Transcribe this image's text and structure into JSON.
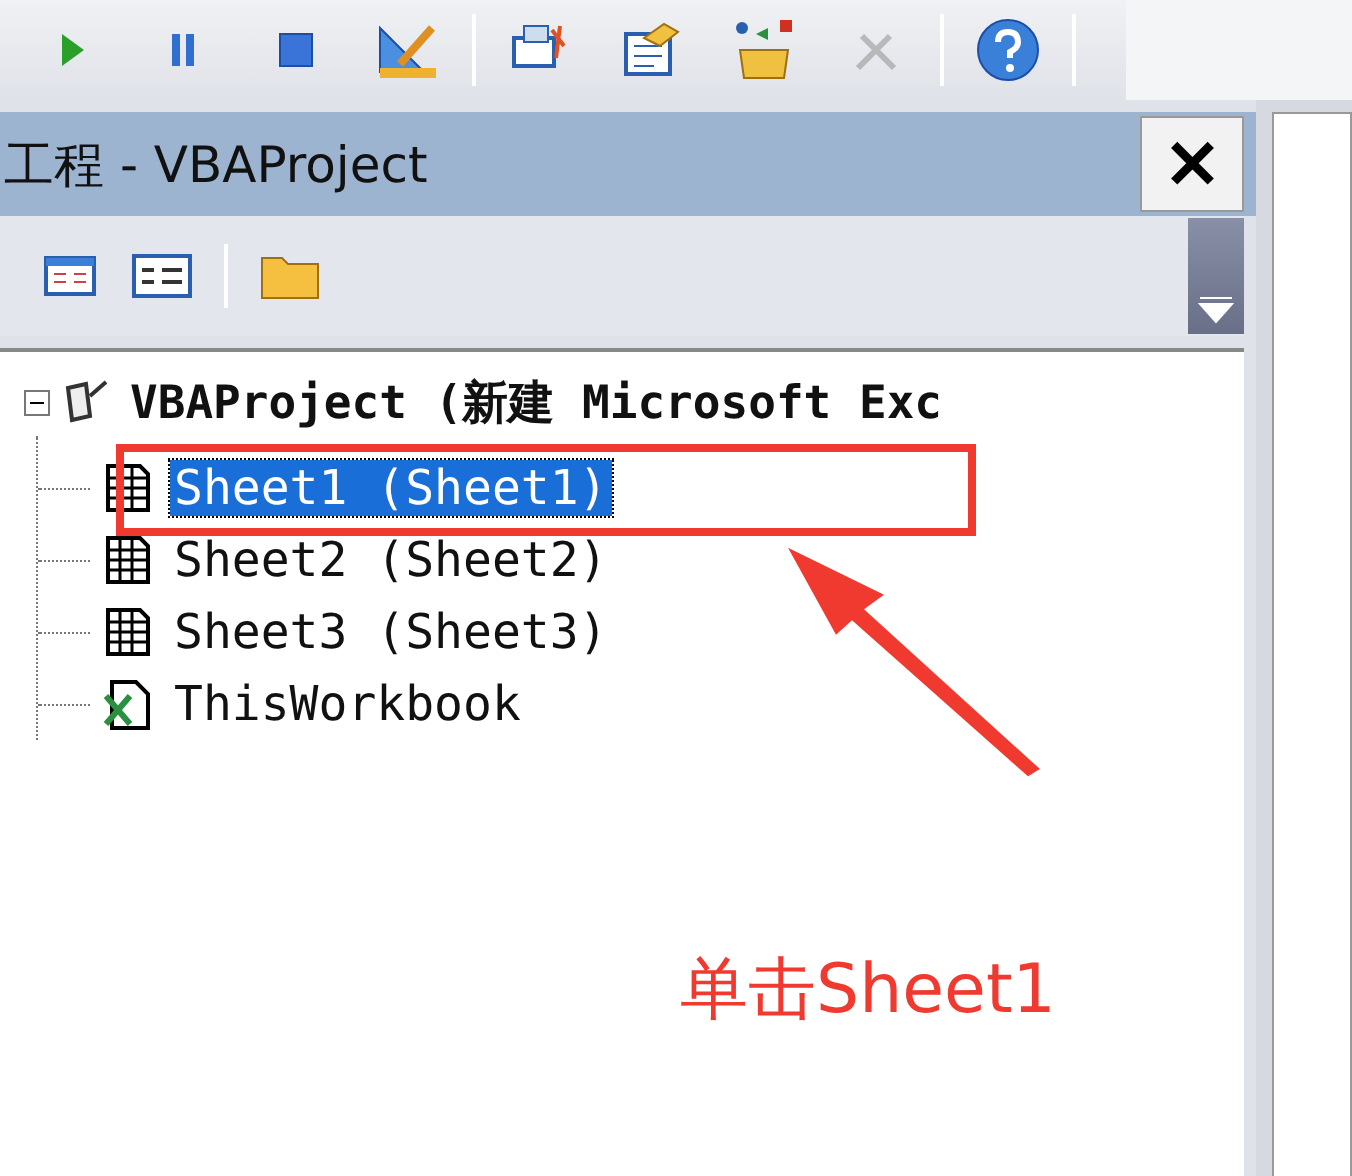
{
  "toolbar": {
    "buttons": [
      {
        "kind": "run",
        "disabled": false
      },
      {
        "kind": "pause",
        "disabled": false
      },
      {
        "kind": "stop",
        "disabled": false
      },
      {
        "kind": "design",
        "disabled": false
      },
      {
        "kind": "sep"
      },
      {
        "kind": "explorer",
        "disabled": false
      },
      {
        "kind": "properties",
        "disabled": false
      },
      {
        "kind": "objects",
        "disabled": false
      },
      {
        "kind": "tools",
        "disabled": true
      },
      {
        "kind": "sep"
      },
      {
        "kind": "help",
        "disabled": false
      }
    ]
  },
  "panel": {
    "title": "工程 - VBAProject",
    "close": "✕"
  },
  "tree": {
    "label": "VBAProject (新建 Microsoft Exc",
    "expanded": true,
    "children": [
      {
        "kind": "sheet",
        "label": "Sheet1 (Sheet1)",
        "selected": true
      },
      {
        "kind": "sheet",
        "label": "Sheet2 (Sheet2)",
        "selected": false
      },
      {
        "kind": "sheet",
        "label": "Sheet3 (Sheet3)",
        "selected": false
      },
      {
        "kind": "workbook",
        "label": "ThisWorkbook",
        "selected": false
      }
    ]
  },
  "annotation": {
    "text": "单击Sheet1"
  }
}
